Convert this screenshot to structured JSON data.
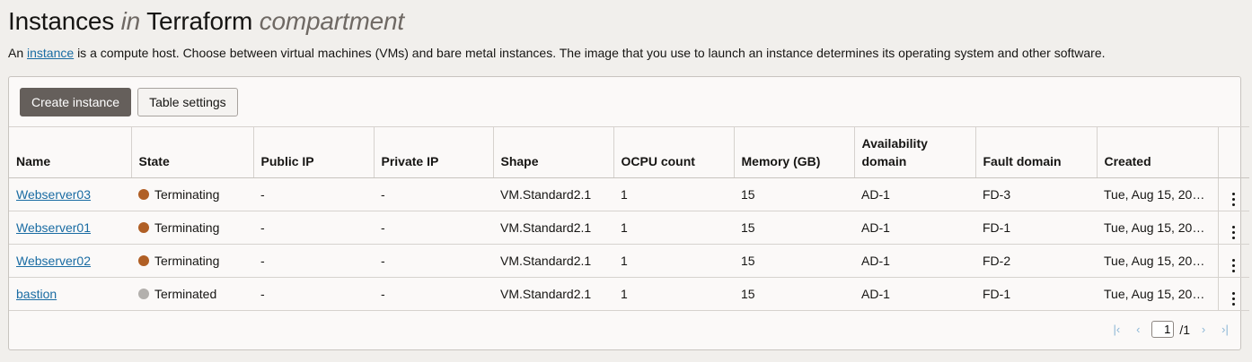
{
  "header": {
    "title_main": "Instances",
    "title_in": "in",
    "title_scope": "Terraform",
    "title_scope_type": "compartment",
    "intro_prefix": "An",
    "intro_link": "instance",
    "intro_rest": "is a compute host. Choose between virtual machines (VMs) and bare metal instances. The image that you use to launch an instance determines its operating system and other software."
  },
  "toolbar": {
    "create_label": "Create instance",
    "settings_label": "Table settings"
  },
  "table": {
    "columns": [
      "Name",
      "State",
      "Public IP",
      "Private IP",
      "Shape",
      "OCPU count",
      "Memory (GB)",
      "Availability domain",
      "Fault domain",
      "Created"
    ],
    "rows": [
      {
        "name": "Webserver03",
        "state": "Terminating",
        "state_color": "#b05f25",
        "public_ip": "-",
        "private_ip": "-",
        "shape": "VM.Standard2.1",
        "ocpu": "1",
        "memory": "15",
        "ad": "AD-1",
        "fd": "FD-3",
        "created": "Tue, Aug 15, 20…"
      },
      {
        "name": "Webserver01",
        "state": "Terminating",
        "state_color": "#b05f25",
        "public_ip": "-",
        "private_ip": "-",
        "shape": "VM.Standard2.1",
        "ocpu": "1",
        "memory": "15",
        "ad": "AD-1",
        "fd": "FD-1",
        "created": "Tue, Aug 15, 20…"
      },
      {
        "name": "Webserver02",
        "state": "Terminating",
        "state_color": "#b05f25",
        "public_ip": "-",
        "private_ip": "-",
        "shape": "VM.Standard2.1",
        "ocpu": "1",
        "memory": "15",
        "ad": "AD-1",
        "fd": "FD-2",
        "created": "Tue, Aug 15, 20…"
      },
      {
        "name": "bastion",
        "state": "Terminated",
        "state_color": "#b3b0ad",
        "public_ip": "-",
        "private_ip": "-",
        "shape": "VM.Standard2.1",
        "ocpu": "1",
        "memory": "15",
        "ad": "AD-1",
        "fd": "FD-1",
        "created": "Tue, Aug 15, 20…"
      }
    ]
  },
  "pagination": {
    "current_page": "1",
    "total_label": "/1",
    "first_icon": "first-page-icon",
    "prev_icon": "previous-page-icon",
    "next_icon": "next-page-icon",
    "last_icon": "last-page-icon"
  },
  "colors": {
    "link": "#1a6ca3",
    "primary_button": "#655f5b",
    "terminating": "#b05f25",
    "terminated": "#b3b0ad"
  }
}
